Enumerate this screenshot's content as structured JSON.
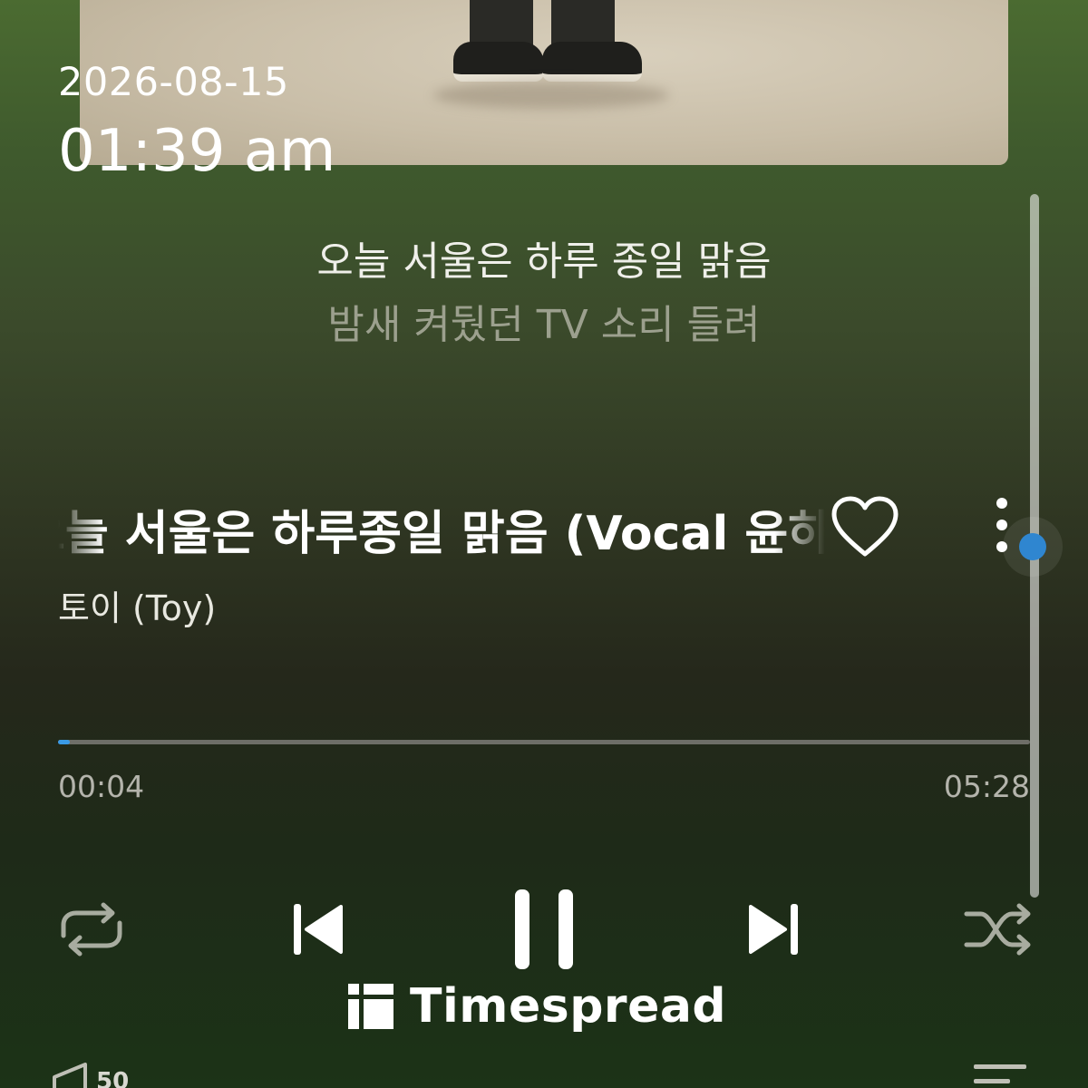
{
  "clock": {
    "date": "2026-08-15",
    "time": "01:39 am"
  },
  "lyrics": {
    "current": "오늘 서울은 하루 종일 맑음",
    "next": "밤새 켜뒀던 TV 소리 들려"
  },
  "track": {
    "title": "오늘 서울은 하루종일 맑음 (Vocal 윤하)",
    "artist": "토이 (Toy)",
    "liked": false
  },
  "playback": {
    "elapsed": "00:04",
    "duration": "05:28",
    "progress_fraction": 0.0125,
    "state": "playing",
    "volume_level": "50"
  },
  "icons": {
    "heart": "heart-icon",
    "more": "more-vertical-icon",
    "repeat": "repeat-icon",
    "previous": "skip-previous-icon",
    "pause": "pause-icon",
    "next": "skip-next-icon",
    "shuffle": "shuffle-icon",
    "speaker": "speaker-icon",
    "queue": "queue-icon"
  },
  "watermark": {
    "text": "Timespread"
  },
  "colors": {
    "accent": "#2f86d0",
    "progress": "#3a9ae6",
    "background_top": "#4b6b31",
    "background_mid": "#25281b",
    "background_bottom": "#1c3317"
  }
}
